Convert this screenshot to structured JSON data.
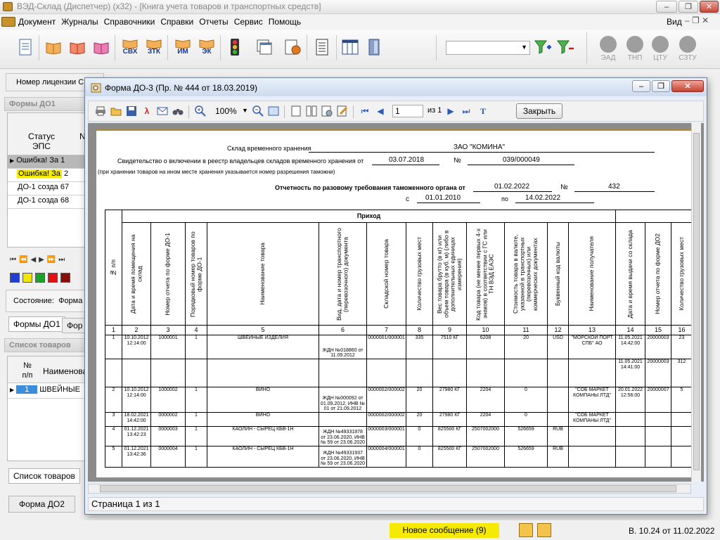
{
  "app": {
    "title": "ВЭД-Склад (Диспетчер) (x32) - [Книга учета товаров и транспортных средств]",
    "view_label": "Вид"
  },
  "menu": [
    {
      "label": "Документ"
    },
    {
      "label": "Журналы"
    },
    {
      "label": "Справочники"
    },
    {
      "label": "Справки"
    },
    {
      "label": "Отчеты"
    },
    {
      "label": "Сервис"
    },
    {
      "label": "Помощь"
    }
  ],
  "toolbar": {
    "buttons": [
      "СВХ",
      "ЗТК",
      "ИМ",
      "ЭК"
    ],
    "filter_value": "",
    "status_lights": [
      "ЭАД",
      "ТНП",
      "ЦТУ",
      "СЗТУ"
    ]
  },
  "license_label": "Номер лицензии СВ",
  "left_panel": {
    "forms_header": "Формы ДО1",
    "forms_col_status": "Статус ЭПС",
    "forms_rows": [
      {
        "status": "Ошибка! За",
        "num": "1"
      },
      {
        "status": "Ошибка! За",
        "num": "2"
      },
      {
        "status": "ДО-1 созда",
        "num": "67"
      },
      {
        "status": "ДО-1 созда",
        "num": "68"
      }
    ],
    "color_swatches": [
      "#1f3fd6",
      "#f2e600",
      "#19a32d",
      "#e01212",
      "#8a0d0d"
    ],
    "state_label": "Состояние:",
    "state_value": "Форма",
    "tab_forms": "Формы ДО1",
    "tab_forms2": "Фор",
    "goods_header": "Список товаров",
    "goods_col_num": "№ п/п",
    "goods_col_name": "Наименова",
    "goods_rows": [
      {
        "num": "1",
        "name": "ШВЕЙНЫЕ"
      }
    ],
    "tab_goods": "Список товаров",
    "btn_form_do2": "Форма ДО2"
  },
  "dialog": {
    "title": "Форма ДО-3 (Пр. № 444 от 18.03.2019)",
    "zoom": "100%",
    "page_input": "1",
    "page_of": "из 1",
    "close_label": "Закрыть",
    "status": "Страница 1 из 1"
  },
  "report": {
    "warehouse_label": "Склад временного хранения",
    "warehouse_name": "ЗАО \"КОМИНА\"",
    "cert_label": "Свидетельство о включении в реестр владельцев складов временного хранения от",
    "cert_date": "03.07.2018",
    "num_sign": "№",
    "cert_num": "039/000049",
    "note": "(при хранении товаров на ином месте хранения указывается номер разрешения таможни)",
    "report_label": "Отчетность по разовому требования таможенного органа от",
    "report_date": "01.02.2022",
    "report_num": "432",
    "from_label": "с",
    "from_date": "01.01.2010",
    "to_label": "по",
    "to_date": "14.02.2022",
    "prihod": "Приход",
    "headers": [
      "№ п/п",
      "Дата и время помещения на склад",
      "Номер отчета по форме ДО-1",
      "Порядковый номер товаров по форме ДО-1",
      "Наименование товара",
      "Вид, дата и номер транспортного (перевозочного) документа",
      "Складской номер товара",
      "Количество грузовых мест",
      "Вес товара брутто (в кг) или объем товара (в куб. м) (либо в дополнительных единицах измерения)",
      "Код товара (не менее первых 4-х знаков) в соответствии с ГС или ТН ВЭД ЕАЭС",
      "Стоимость товара в валюте, указанной в транспортных (перевозочных) или коммерческих документах",
      "Буквенный код валюты",
      "Наименование получателя",
      "Дата и время выдачи со склада",
      "Номер отчета по форме ДО2",
      "Количество грузовых мест"
    ],
    "col_numbers": [
      "1",
      "2",
      "3",
      "4",
      "5",
      "6",
      "7",
      "8",
      "9",
      "10",
      "11",
      "12",
      "13",
      "14",
      "15",
      "16"
    ],
    "rows": [
      [
        "1",
        "10.10.2012 12:14:00",
        "1000001",
        "1",
        "ШВЕЙНЫЕ ИЗДЕЛИЯ",
        "ЖДН №018860 от 11.09.2012",
        "0000001/000001",
        "335",
        "7510 КГ",
        "6208",
        "20",
        "USD",
        "\"МОРСКОЙ ПОРТ СПБ\" АО",
        "11.05.2021 14:42:00",
        "20000003",
        "23"
      ],
      [
        "",
        "",
        "",
        "",
        "",
        "",
        "",
        "",
        "",
        "",
        "",
        "",
        "",
        "11.05.2021 14:41:00",
        "20000003",
        "312"
      ],
      [
        "2",
        "10.10.2012 12:14:00",
        "1000002",
        "1",
        "ВИНО",
        "ЖДН №000092 от 01.09.2012, ИНВ № 01 от 21.09.2012",
        "0000002/000002",
        "20",
        "27980 КГ",
        "2204",
        "0",
        "",
        "\"СОБ МАРКЕТ КОМПАНЫ ЛТД\"",
        "20.01.2022 12:56:00",
        "20000007",
        "5"
      ],
      [
        "3",
        "18.02.2021 14:42:00",
        "0000002",
        "1",
        "ВИНО",
        "",
        "0000002/000002",
        "20",
        "27980 КГ",
        "2204",
        "0",
        "",
        "\"СОБ МАРКЕТ КОМПАНЫ ЛТД\"",
        "",
        "",
        ""
      ],
      [
        "4",
        "01.12.2021 13:42:23",
        "0000003",
        "1",
        "КАОЛИН - СЫРЕЦ КБВ-1Н",
        "ЖДН №49331978 от 23.06.2020, ИНВ № 59 от 23.06.2020",
        "0000003/000001",
        "0",
        "825500 КГ",
        "2507002000",
        "526659",
        "RUB",
        "",
        "",
        "",
        ""
      ],
      [
        "5",
        "01.12.2021 13:42:36",
        "0000004",
        "1",
        "КАОЛИН - СЫРЕЦ КБВ-1Н",
        "ЖДН №49331937 от 23.06.2020, ИНВ № 59 от 23.06.2020",
        "0000004/000001",
        "0",
        "825500 КГ",
        "2507002000",
        "526659",
        "RUB",
        "",
        "",
        "",
        ""
      ]
    ]
  },
  "bottom": {
    "new_message": "Новое сообщение (9)",
    "version": "В. 10.24 от 11.02.2022"
  }
}
